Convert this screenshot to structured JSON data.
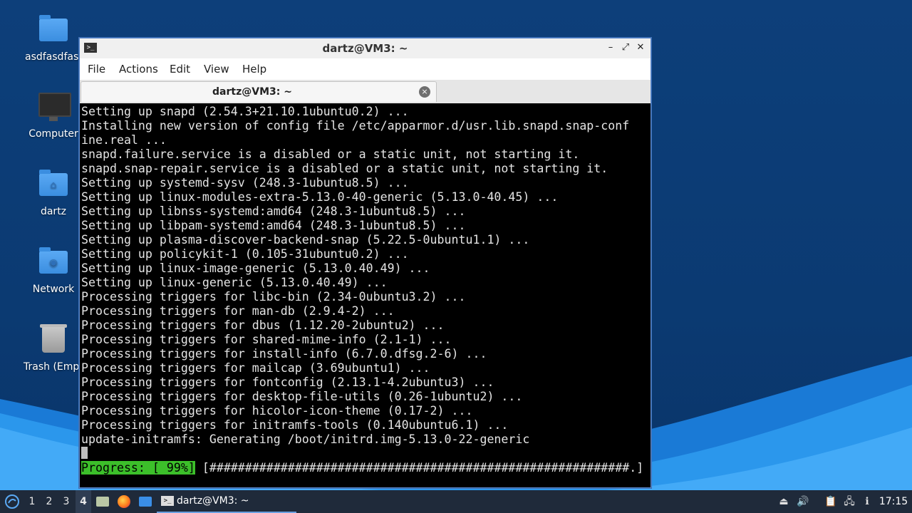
{
  "desktop": {
    "icons": [
      {
        "label": "asdfasdfasdf",
        "icon": "folder-icon"
      },
      {
        "label": "Computer",
        "icon": "computer-icon"
      },
      {
        "label": "dartz",
        "icon": "home-folder-icon"
      },
      {
        "label": "Network",
        "icon": "network-folder-icon"
      },
      {
        "label": "Trash (Empty)",
        "icon": "trash-icon"
      }
    ]
  },
  "window": {
    "title": "dartz@VM3: ~",
    "controls": {
      "minimize": "–",
      "maximize": "⤢",
      "close": "✕"
    },
    "menu": [
      "File",
      "Actions",
      "Edit",
      "View",
      "Help"
    ],
    "tab": {
      "label": "dartz@VM3: ~",
      "close": "×"
    }
  },
  "terminal": {
    "lines": [
      "Setting up snapd (2.54.3+21.10.1ubuntu0.2) ...",
      "Installing new version of config file /etc/apparmor.d/usr.lib.snapd.snap-conf",
      "ine.real ...",
      "snapd.failure.service is a disabled or a static unit, not starting it.",
      "snapd.snap-repair.service is a disabled or a static unit, not starting it.",
      "Setting up systemd-sysv (248.3-1ubuntu8.5) ...",
      "Setting up linux-modules-extra-5.13.0-40-generic (5.13.0-40.45) ...",
      "Setting up libnss-systemd:amd64 (248.3-1ubuntu8.5) ...",
      "Setting up libpam-systemd:amd64 (248.3-1ubuntu8.5) ...",
      "Setting up plasma-discover-backend-snap (5.22.5-0ubuntu1.1) ...",
      "Setting up policykit-1 (0.105-31ubuntu0.2) ...",
      "Setting up linux-image-generic (5.13.0.40.49) ...",
      "Setting up linux-generic (5.13.0.40.49) ...",
      "Processing triggers for libc-bin (2.34-0ubuntu3.2) ...",
      "Processing triggers for man-db (2.9.4-2) ...",
      "Processing triggers for dbus (1.12.20-2ubuntu2) ...",
      "Processing triggers for shared-mime-info (2.1-1) ...",
      "Processing triggers for install-info (6.7.0.dfsg.2-6) ...",
      "Processing triggers for mailcap (3.69ubuntu1) ...",
      "Processing triggers for fontconfig (2.13.1-4.2ubuntu3) ...",
      "Processing triggers for desktop-file-utils (0.26-1ubuntu2) ...",
      "Processing triggers for hicolor-icon-theme (0.17-2) ...",
      "Processing triggers for initramfs-tools (0.140ubuntu6.1) ...",
      "update-initramfs: Generating /boot/initrd.img-5.13.0-22-generic"
    ],
    "progress_label": "Progress: [ 99%]",
    "progress_bar": " [###########################################################.]",
    "progress_percent": 99,
    "colors": {
      "background": "#000000",
      "text": "#e4e4e4",
      "progress": "#3cbf2a"
    }
  },
  "taskbar": {
    "workspaces": [
      "1",
      "2",
      "3",
      "4"
    ],
    "active_workspace": "4",
    "launchers": [
      "files-icon",
      "firefox-icon",
      "desktop-icon"
    ],
    "task": {
      "label": "dartz@VM3: ~",
      "icon": "terminal-icon"
    },
    "tray_icons": [
      "eject-icon",
      "volume-icon",
      "clipboard-icon",
      "network-icon",
      "notification-icon"
    ],
    "clock": "17:15"
  }
}
